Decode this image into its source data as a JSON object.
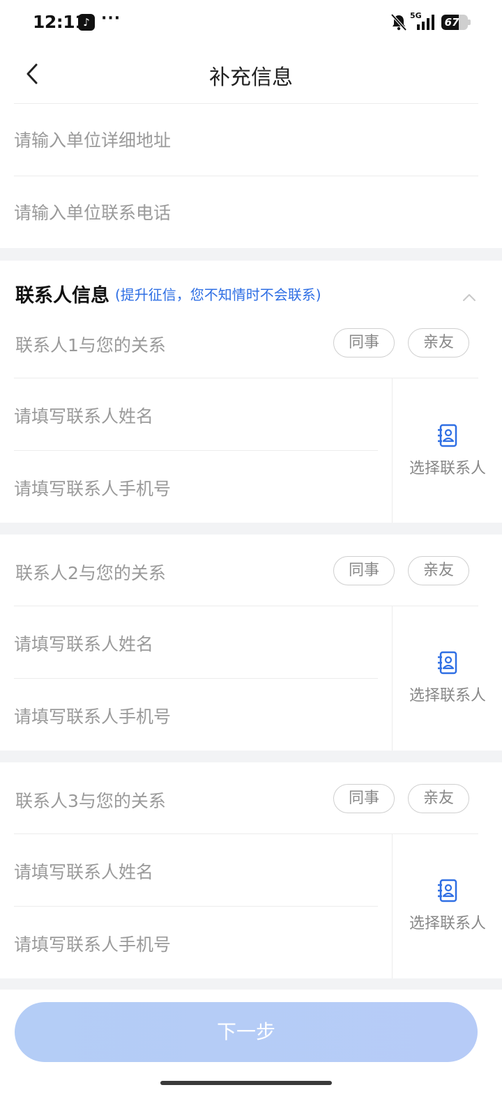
{
  "status_bar": {
    "time": "12:11",
    "app_icon": "tiktok-icon",
    "more": "···",
    "network": "5G",
    "battery_level": "67"
  },
  "nav": {
    "title": "补充信息",
    "back_icon": "chevron-left-icon"
  },
  "company": {
    "address_placeholder": "请输入单位详细地址",
    "phone_placeholder": "请输入单位联系电话"
  },
  "contacts_section": {
    "title": "联系人信息",
    "hint": "(提升征信，您不知情时不会联系)",
    "collapse_icon": "chevron-up-icon"
  },
  "contacts": [
    {
      "relation_label": "联系人1与您的关系",
      "options": [
        "同事",
        "亲友"
      ],
      "name_placeholder": "请填写联系人姓名",
      "phone_placeholder": "请填写联系人手机号",
      "pick_label": "选择联系人"
    },
    {
      "relation_label": "联系人2与您的关系",
      "options": [
        "同事",
        "亲友"
      ],
      "name_placeholder": "请填写联系人姓名",
      "phone_placeholder": "请填写联系人手机号",
      "pick_label": "选择联系人"
    },
    {
      "relation_label": "联系人3与您的关系",
      "options": [
        "同事",
        "亲友"
      ],
      "name_placeholder": "请填写联系人姓名",
      "phone_placeholder": "请填写联系人手机号",
      "pick_label": "选择联系人"
    }
  ],
  "footer": {
    "next_label": "下一步"
  },
  "colors": {
    "accent": "#2f6fe4",
    "button_disabled": "#b4cdf6",
    "section_gap": "#f2f3f5"
  }
}
